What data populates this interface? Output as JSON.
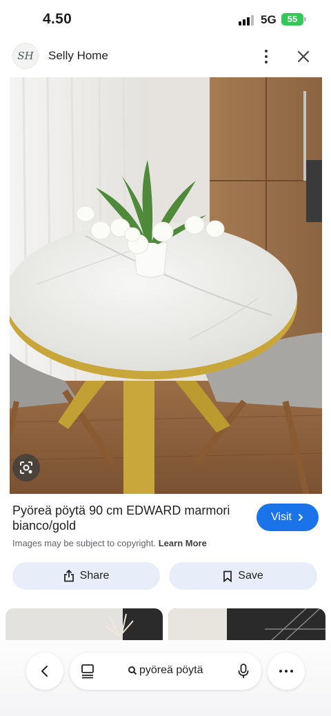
{
  "status": {
    "time": "4.50",
    "network": "5G",
    "battery": "55"
  },
  "header": {
    "logo_text": "SH",
    "site_name": "Selly Home"
  },
  "result": {
    "title": "Pyöreä pöytä 90 cm EDWARD marmori bianco/gold",
    "visit_label": "Visit",
    "copyright_text": "Images may be subject to copyright.",
    "learn_more_label": "Learn More",
    "share_label": "Share",
    "save_label": "Save"
  },
  "bottom_nav": {
    "search_query": "pyöreä pöytä"
  },
  "colors": {
    "accent": "#1a73e8",
    "pill_bg": "#e8eef9",
    "battery": "#34c759"
  },
  "icons": [
    "close-icon",
    "more-vert-icon",
    "google-lens-icon",
    "chevron-right-icon",
    "share-icon",
    "bookmark-icon",
    "back-arrow-icon",
    "tabs-icon",
    "search-icon",
    "mic-icon",
    "more-horiz-icon"
  ]
}
